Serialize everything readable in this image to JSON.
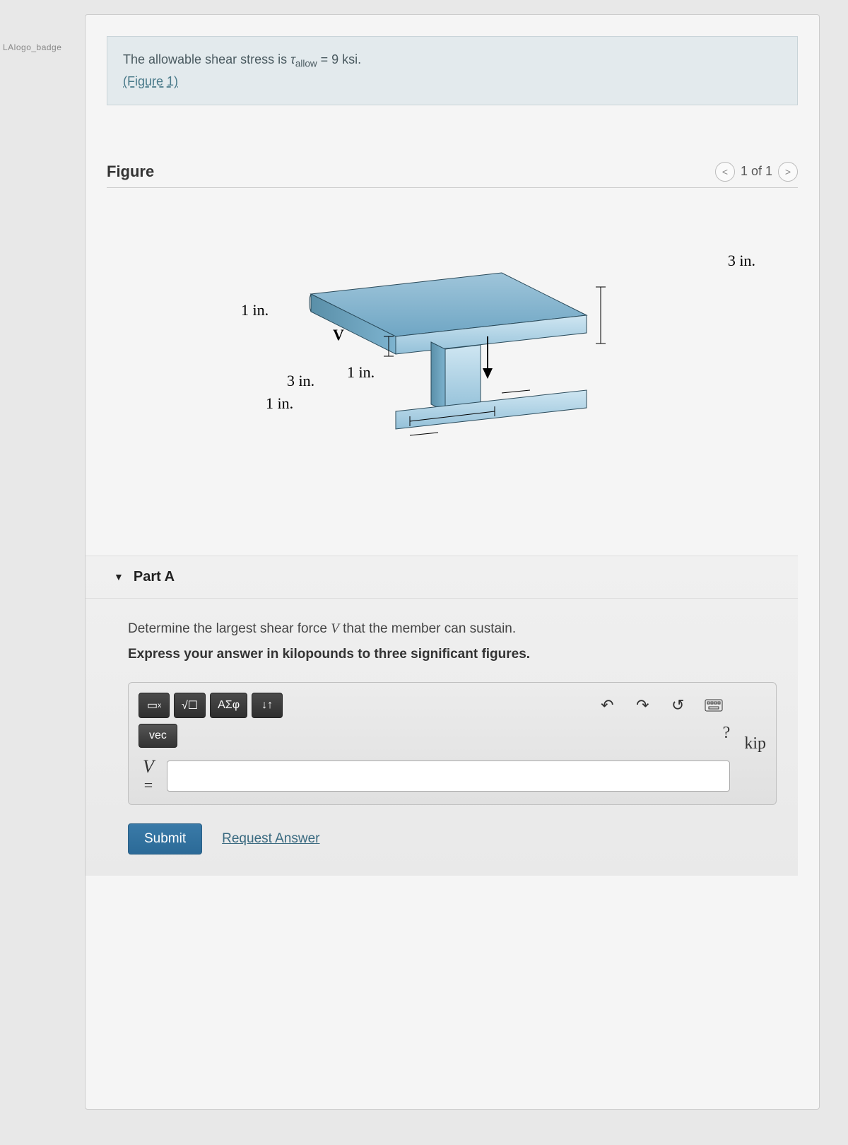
{
  "badge": "LAlogo_badge",
  "intro": {
    "prefix": "The allowable shear stress is ",
    "tau": "τ",
    "subscript": "allow",
    "equals": " = ",
    "value": "9 ksi.",
    "figure_link": "(Figure 1)"
  },
  "figure": {
    "title": "Figure",
    "pager_text": "1 of 1",
    "prev": "<",
    "next": ">",
    "dims": {
      "top_right": "3 in.",
      "left": "1 in.",
      "v_label": "V",
      "bottom_mid": "3 in.",
      "bottom_right": "1 in.",
      "bottom_left": "1 in."
    }
  },
  "part": {
    "label": "Part A",
    "prompt_prefix": "Determine the largest shear force ",
    "prompt_var": "V",
    "prompt_suffix": " that the member can sustain.",
    "hint": "Express your answer in kilopounds to three significant figures.",
    "toolbar": {
      "templates": "▭",
      "root": "√☐",
      "greek": "ΑΣφ",
      "updown": "↓↑",
      "undo": "↶",
      "redo": "↷",
      "reset": "↺",
      "keyboard": "⌨",
      "vec": "vec",
      "help": "?"
    },
    "var": "V",
    "eq": "=",
    "unit": "kip",
    "submit": "Submit",
    "request": "Request Answer"
  }
}
